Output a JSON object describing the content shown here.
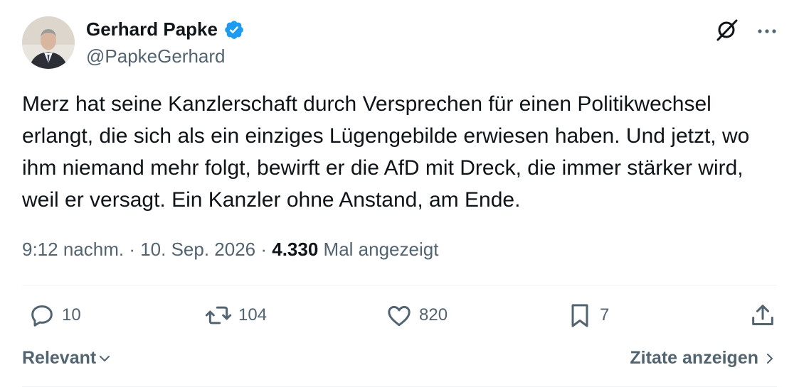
{
  "author": {
    "name": "Gerhard Papke",
    "handle": "@PapkeGerhard",
    "verified": true
  },
  "tweet": {
    "text": "Merz hat seine Kanzlerschaft durch Versprechen für einen Politikwechsel erlangt, die sich als ein einziges Lügengebilde erwiesen haben. Und jetzt, wo ihm niemand mehr folgt, bewirft er die AfD mit Dreck, die immer stärker wird, weil er versagt. Ein Kanzler ohne Anstand, am Ende.",
    "time": "9:12 nachm.",
    "separator": " · ",
    "date": "10. Sep. 2026",
    "views": "4.330",
    "views_label": " Mal angezeigt"
  },
  "actions": {
    "replies": "10",
    "reposts": "104",
    "likes": "820",
    "bookmarks": "7"
  },
  "footer": {
    "sort_label": "Relevant",
    "quotes_label": "Zitate anzeigen"
  },
  "icons": {
    "top_right": [
      "grok-icon",
      "more-icon"
    ],
    "actions": [
      "reply-icon",
      "repost-icon",
      "like-icon",
      "bookmark-icon",
      "share-icon"
    ]
  },
  "colors": {
    "verified": "#1d9bf0",
    "text": "#0f1419",
    "secondary": "#536471"
  }
}
